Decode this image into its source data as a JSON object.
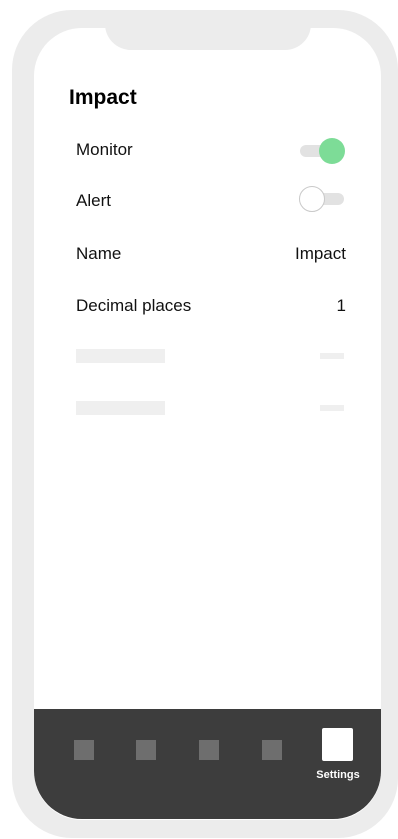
{
  "page": {
    "title": "Impact"
  },
  "settings": {
    "monitor": {
      "label": "Monitor",
      "enabled": true
    },
    "alert": {
      "label": "Alert",
      "enabled": false
    },
    "name": {
      "label": "Name",
      "value": "Impact"
    },
    "decimal_places": {
      "label": "Decimal places",
      "value": "1"
    }
  },
  "tabbar": {
    "tabs": [
      {
        "icon": "tab-placeholder-icon",
        "label": ""
      },
      {
        "icon": "tab-placeholder-icon",
        "label": ""
      },
      {
        "icon": "tab-placeholder-icon",
        "label": ""
      },
      {
        "icon": "tab-placeholder-icon",
        "label": ""
      },
      {
        "icon": "settings-icon",
        "label": "Settings",
        "active": true
      }
    ]
  },
  "colors": {
    "toggle_on": "#7ddc97",
    "tabbar_bg": "#3d3d3d",
    "frame": "#ececec"
  }
}
